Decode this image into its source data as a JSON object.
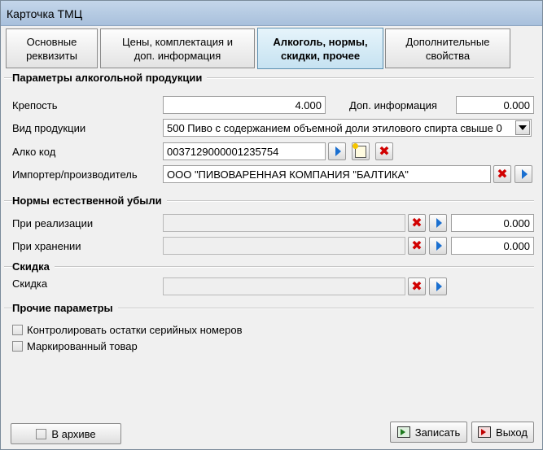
{
  "window": {
    "title": "Карточка ТМЦ"
  },
  "tabs": [
    {
      "label": "Основные\nреквизиты",
      "active": false
    },
    {
      "label": "Цены, комплектация и\nдоп.  информация",
      "active": false
    },
    {
      "label": "Алкоголь, нормы,\nскидки, прочее",
      "active": true
    },
    {
      "label": "Дополнительные\nсвойства",
      "active": false
    }
  ],
  "alcohol": {
    "title": "Параметры алкогольной продукции",
    "strength_label": "Крепость",
    "strength_value": "4.000",
    "extra_info_label": "Доп. информация",
    "extra_info_value": "0.000",
    "product_type_label": "Вид продукции",
    "product_type_value": "500 Пиво с содержанием объемной доли этилового спирта свыше 0",
    "alco_code_label": "Алко код",
    "alco_code_value": "0037129000001235754",
    "importer_label": "Импортер/производитель",
    "importer_value": "ООО \"ПИВОВАРЕННАЯ КОМПАНИЯ \"БАЛТИКА\""
  },
  "loss": {
    "title": "Нормы естественной убыли",
    "sale_label": "При реализации",
    "sale_field": "",
    "sale_value": "0.000",
    "storage_label": "При хранении",
    "storage_field": "",
    "storage_value": "0.000"
  },
  "discount": {
    "title": "Скидка",
    "label": "Скидка",
    "field": ""
  },
  "other": {
    "title": "Прочие параметры",
    "serial_control_label": "Контролировать остатки серийных номеров",
    "serial_control_checked": false,
    "marked_label": "Маркированный товар",
    "marked_checked": false
  },
  "footer": {
    "archive_label": "В архиве",
    "archive_checked": false,
    "save_label": "Записать",
    "exit_label": "Выход"
  },
  "icons": {
    "clear": "red-x-icon",
    "select": "blue-arrow-icon",
    "new": "new-document-icon"
  },
  "colors": {
    "clear_icon": "#d10000",
    "select_icon": "#1a6fd0",
    "active_tab": "#c6e2f1"
  }
}
